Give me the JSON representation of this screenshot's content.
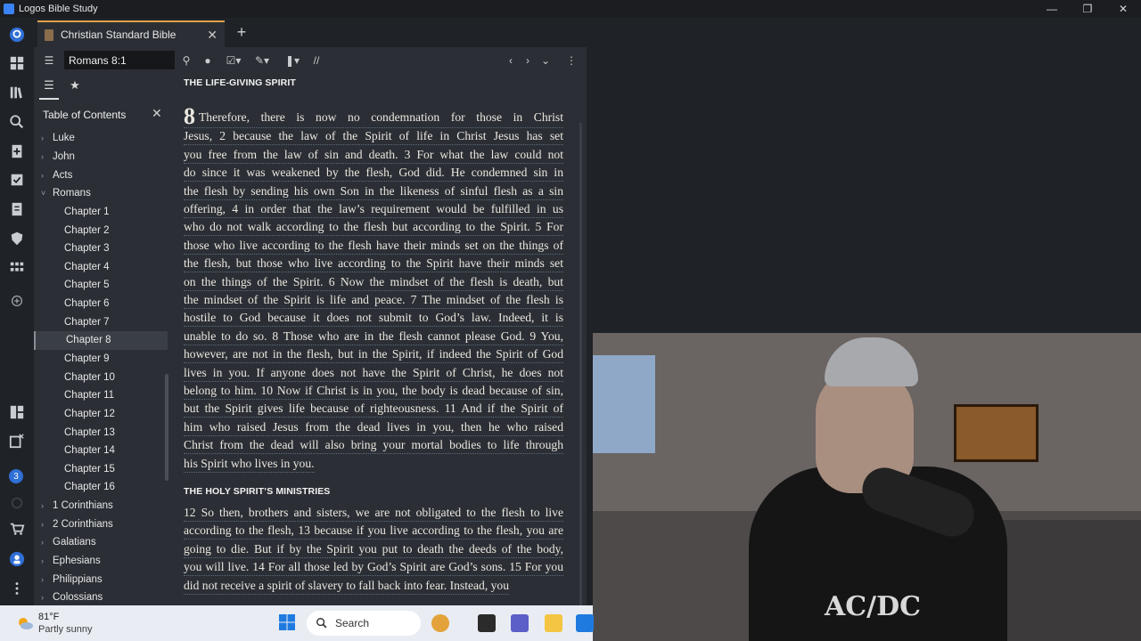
{
  "window": {
    "title": "Logos Bible Study",
    "controls": [
      "minimize",
      "restore",
      "close"
    ]
  },
  "tabs": [
    {
      "label": "Christian Standard Bible"
    }
  ],
  "toolbar": {
    "reference": "Romans 8:1"
  },
  "toc": {
    "title": "Table of Contents",
    "items": [
      {
        "label": "Luke",
        "type": "book",
        "expanded": false
      },
      {
        "label": "John",
        "type": "book",
        "expanded": false
      },
      {
        "label": "Acts",
        "type": "book",
        "expanded": false
      },
      {
        "label": "Romans",
        "type": "book",
        "expanded": true
      },
      {
        "label": "Chapter 1",
        "type": "chapter"
      },
      {
        "label": "Chapter 2",
        "type": "chapter"
      },
      {
        "label": "Chapter 3",
        "type": "chapter"
      },
      {
        "label": "Chapter 4",
        "type": "chapter"
      },
      {
        "label": "Chapter 5",
        "type": "chapter"
      },
      {
        "label": "Chapter 6",
        "type": "chapter"
      },
      {
        "label": "Chapter 7",
        "type": "chapter"
      },
      {
        "label": "Chapter 8",
        "type": "chapter",
        "selected": true
      },
      {
        "label": "Chapter 9",
        "type": "chapter"
      },
      {
        "label": "Chapter 10",
        "type": "chapter"
      },
      {
        "label": "Chapter 11",
        "type": "chapter"
      },
      {
        "label": "Chapter 12",
        "type": "chapter"
      },
      {
        "label": "Chapter 13",
        "type": "chapter"
      },
      {
        "label": "Chapter 14",
        "type": "chapter"
      },
      {
        "label": "Chapter 15",
        "type": "chapter"
      },
      {
        "label": "Chapter 16",
        "type": "chapter"
      },
      {
        "label": "1 Corinthians",
        "type": "book",
        "expanded": false
      },
      {
        "label": "2 Corinthians",
        "type": "book",
        "expanded": false
      },
      {
        "label": "Galatians",
        "type": "book",
        "expanded": false
      },
      {
        "label": "Ephesians",
        "type": "book",
        "expanded": false
      },
      {
        "label": "Philippians",
        "type": "book",
        "expanded": false
      },
      {
        "label": "Colossians",
        "type": "book",
        "expanded": false
      }
    ]
  },
  "reader": {
    "section1": "THE LIFE-GIVING SPIRIT",
    "chapter_number": "8",
    "lines1": [
      "Therefore, there is now no condemnation for those in Christ",
      "Jesus, 2 because the law of the Spirit of life in Christ Jesus has set",
      "you free from the law of sin and death. 3 For what the law could not",
      "do since it was weakened by the flesh, God did. He condemned sin in",
      "the flesh by sending his own Son in the likeness of sinful flesh as a sin",
      "offering, 4 in order that the law’s requirement would be fulfilled in us",
      "who do not walk according to the flesh but according to the Spirit. 5 For",
      "those who live according to the flesh have their minds set on the things of",
      "the flesh, but those who live according to the Spirit have their minds set",
      "on the things of the Spirit. 6 Now the mindset of the flesh is death, but",
      "the mindset of the Spirit is life and peace. 7 The mindset of the flesh is",
      "hostile to God because it does not submit to God’s law. Indeed, it is",
      "unable to do so. 8 Those who are in the flesh cannot please God. 9 You,",
      "however, are not in the flesh, but in the Spirit, if indeed the Spirit of God",
      "lives in you. If anyone does not have the Spirit of Christ, he does not",
      "belong to him. 10 Now if Christ is in you, the body is dead because of sin,",
      "but the Spirit gives life because of righteousness. 11 And if the Spirit of",
      "him who raised Jesus from the dead lives in you, then he who raised",
      "Christ from the dead will also bring your mortal bodies to life through",
      "his Spirit who lives in you."
    ],
    "section2": "THE HOLY SPIRIT’S MINISTRIES",
    "lines2": [
      "12 So then, brothers and sisters, we are not obligated to the flesh to live",
      "according to the flesh, 13 because if you live according to the flesh, you are",
      "going to die. But if by the Spirit you put to death the deeds of the body,",
      "you will live. 14 For all those led by God’s Spirit are God’s sons. 15 For you",
      "did not receive a spirit of slavery to fall back into fear. Instead, you"
    ]
  },
  "rail": {
    "notification_count": "3"
  },
  "taskbar": {
    "weather_temp": "81°F",
    "weather_desc": "Partly sunny",
    "search_label": "Search"
  },
  "webcam": {
    "shirt_text": "AC/DC"
  },
  "colors": {
    "accent_tab": "#e0a14a",
    "panel_bg": "#2b2f35",
    "rail_bg": "#1f2328",
    "link_blue": "#2f6fd6"
  }
}
